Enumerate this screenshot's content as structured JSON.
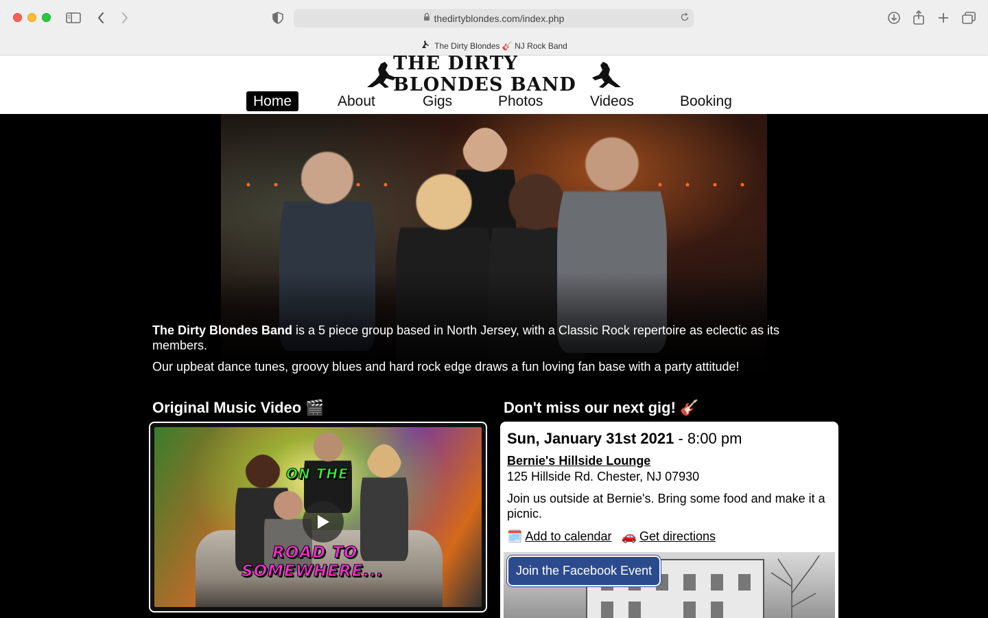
{
  "browser": {
    "url": "thedirtyblondes.com/index.php",
    "tab_title": "The Dirty Blondes 🎸 NJ Rock Band",
    "icons": [
      "sidebar-icon",
      "back-icon",
      "forward-icon",
      "privacy-shield-icon",
      "lock-icon",
      "reload-icon",
      "download-icon",
      "share-icon",
      "new-tab-icon",
      "tab-overview-icon"
    ]
  },
  "site": {
    "logo_text": "THE DIRTY BLONDES BAND",
    "nav": [
      {
        "label": "Home",
        "active": true
      },
      {
        "label": "About"
      },
      {
        "label": "Gigs"
      },
      {
        "label": "Photos"
      },
      {
        "label": "Videos"
      },
      {
        "label": "Booking"
      }
    ]
  },
  "intro": {
    "band_name": "The Dirty Blondes Band",
    "line1_rest": " is a 5 piece group based in North Jersey, with a Classic Rock repertoire as eclectic as its members.",
    "line2": "Our upbeat dance tunes, groovy blues and hard rock edge draws a fun loving fan base with a party attitude!"
  },
  "video": {
    "title": "Original Music Video 🎬",
    "thumb_line1": "ON THE",
    "thumb_line2": "ROAD TO",
    "thumb_line3": "SOMEWHERE..."
  },
  "gig": {
    "title": "Don't miss our next gig! 🎸",
    "date": "Sun, January 31st 2021",
    "time": " - 8:00 pm",
    "venue": "Bernie's Hillside Lounge",
    "address": "125 Hillside Rd. Chester, NJ 07930",
    "description": "Join us outside at Bernie's. Bring some food and make it a picnic.",
    "calendar_emoji": "🗓️",
    "calendar_label": "Add to calendar",
    "directions_emoji": "🚗",
    "directions_label": "Get directions",
    "facebook_label": "Join the Facebook Event"
  },
  "colors": {
    "chrome_bg": "#f0eff0",
    "page_bg": "#000000",
    "nav_active_bg": "#000000",
    "facebook_blue": "#2c4b8f"
  }
}
